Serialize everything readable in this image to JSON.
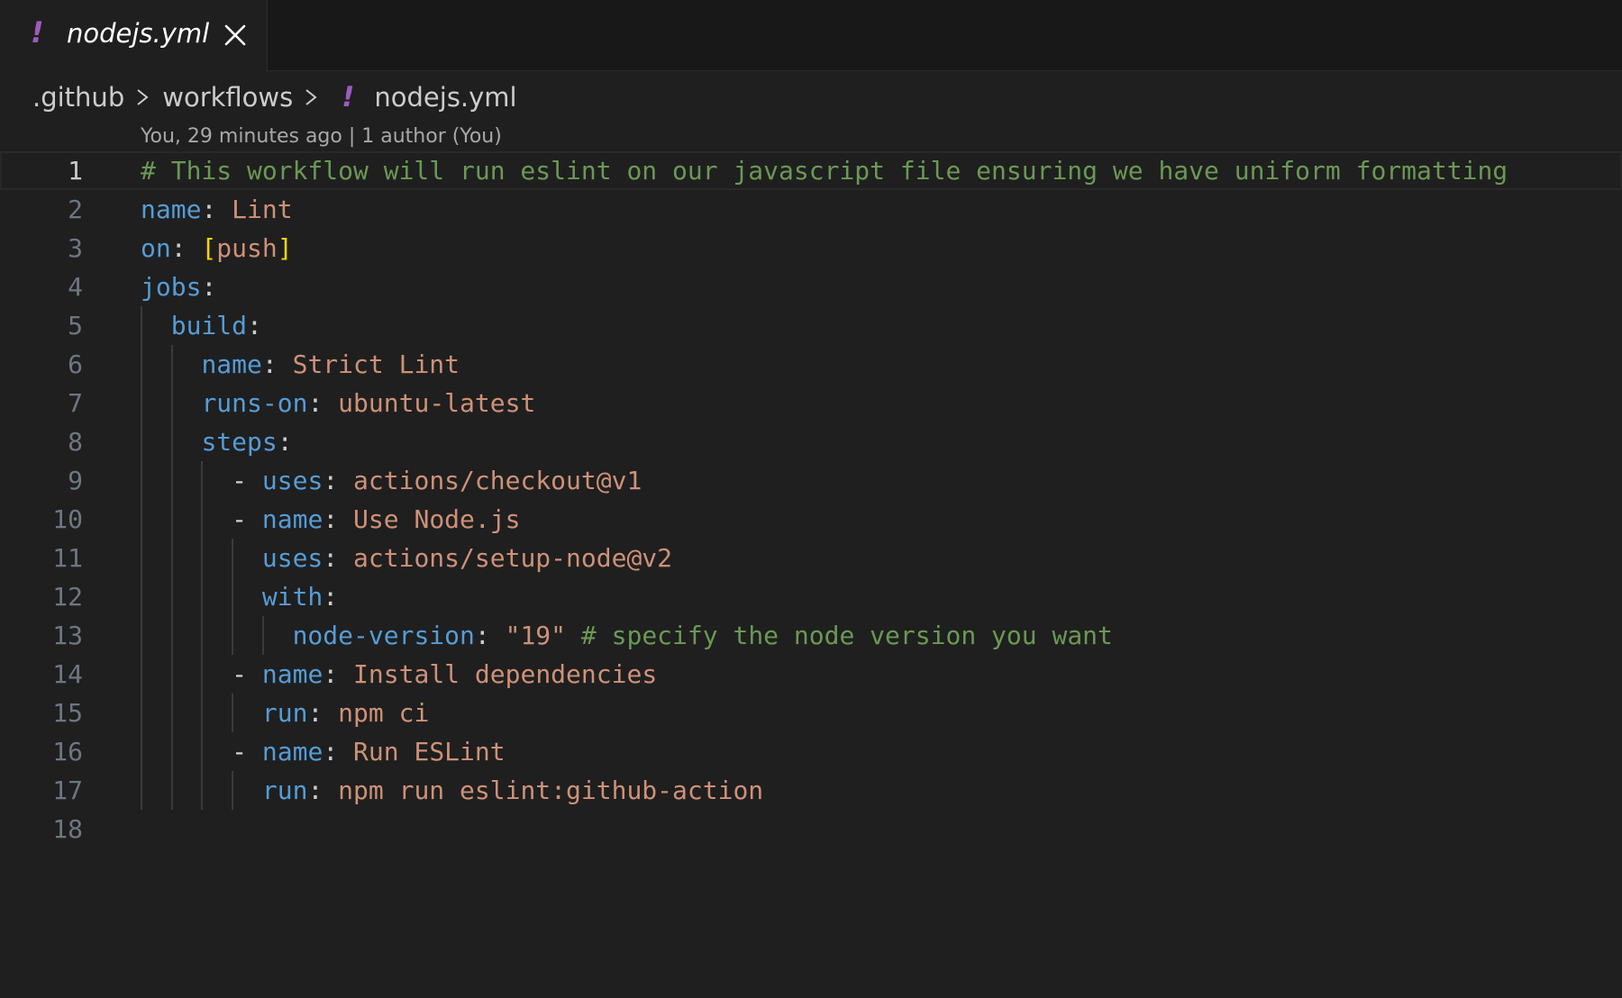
{
  "tab": {
    "label": "nodejs.yml",
    "icon": "yaml-exclamation-icon",
    "icon_glyph": "!",
    "icon_color": "#9c5cbf"
  },
  "breadcrumb": {
    "items": [
      ".github",
      "workflows",
      "nodejs.yml"
    ],
    "file_icon_glyph": "!"
  },
  "blame": {
    "text": "You, 29 minutes ago | 1 author (You)"
  },
  "editor": {
    "language": "yaml",
    "current_line": 1,
    "line_numbers": [
      "1",
      "2",
      "3",
      "4",
      "5",
      "6",
      "7",
      "8",
      "9",
      "10",
      "11",
      "12",
      "13",
      "14",
      "15",
      "16",
      "17",
      "18"
    ],
    "lines": [
      {
        "indent": "",
        "comment": "# This workflow will run eslint on our javascript file ensuring we have uniform formatting"
      },
      {
        "indent": "",
        "key": "name",
        "value": "Lint"
      },
      {
        "indent": "",
        "key": "on",
        "bracket_open": "[",
        "value": "push",
        "bracket_close": "]"
      },
      {
        "indent": "",
        "key": "jobs"
      },
      {
        "indent": "  ",
        "key": "build"
      },
      {
        "indent": "    ",
        "key": "name",
        "value": "Strict Lint"
      },
      {
        "indent": "    ",
        "key": "runs-on",
        "value": "ubuntu-latest"
      },
      {
        "indent": "    ",
        "key": "steps"
      },
      {
        "indent": "      ",
        "dash": "- ",
        "key": "uses",
        "value": "actions/checkout@v1"
      },
      {
        "indent": "      ",
        "dash": "- ",
        "key": "name",
        "value": "Use Node.js"
      },
      {
        "indent": "        ",
        "key": "uses",
        "value": "actions/setup-node@v2"
      },
      {
        "indent": "        ",
        "key": "with"
      },
      {
        "indent": "          ",
        "key": "node-version",
        "value": "\"19\"",
        "comment": " # specify the node version you want"
      },
      {
        "indent": "      ",
        "dash": "- ",
        "key": "name",
        "value": "Install dependencies"
      },
      {
        "indent": "        ",
        "key": "run",
        "value": "npm ci"
      },
      {
        "indent": "      ",
        "dash": "- ",
        "key": "name",
        "value": "Run ESLint"
      },
      {
        "indent": "        ",
        "key": "run",
        "value": "npm run eslint:github-action"
      },
      {
        "indent": ""
      }
    ],
    "colors": {
      "key": "#569cd6",
      "string": "#ce9178",
      "comment": "#6a9955",
      "bracket": "#ffd700",
      "line_number": "#6e7681",
      "background": "#1f1f1f"
    }
  }
}
